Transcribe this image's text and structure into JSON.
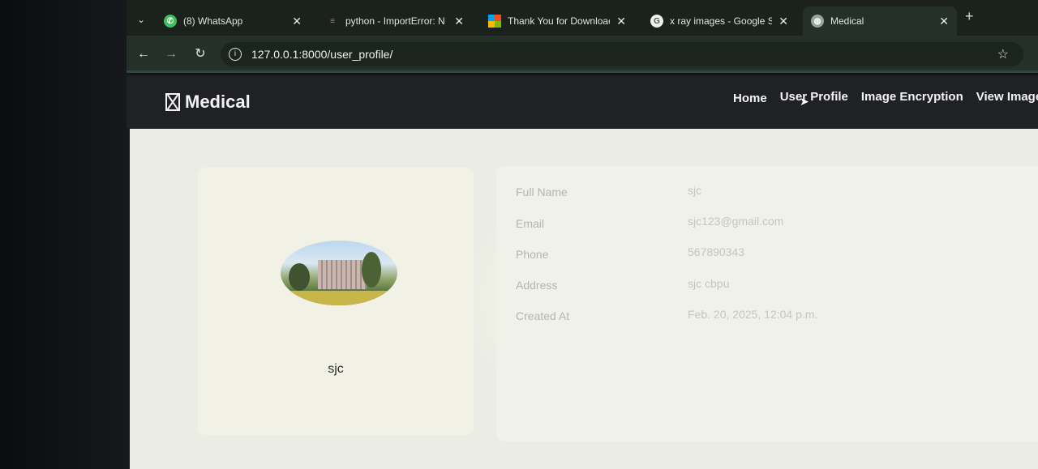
{
  "browser": {
    "tabs": [
      {
        "title": "(8) WhatsApp",
        "favicon": "whatsapp-icon",
        "active": false
      },
      {
        "title": "python - ImportError: N",
        "favicon": "stackoverflow-icon",
        "active": false
      },
      {
        "title": "Thank You for Downloac",
        "favicon": "microsoft-icon",
        "active": false
      },
      {
        "title": "x ray images - Google S",
        "favicon": "google-icon",
        "active": false
      },
      {
        "title": "Medical",
        "favicon": "globe-icon",
        "active": true
      }
    ],
    "url": "127.0.0.1:8000/user_profile/"
  },
  "site": {
    "brand": "Medical",
    "nav": {
      "home": "Home",
      "user_profile": "User Profile",
      "image_encryption": "Image Encryption",
      "view_images": "View Images"
    }
  },
  "profile": {
    "name": "sjc",
    "fields": [
      {
        "label": "Full Name",
        "value": "sjc"
      },
      {
        "label": "Email",
        "value": "sjc123@gmail.com"
      },
      {
        "label": "Phone",
        "value": "567890343"
      },
      {
        "label": "Address",
        "value": "sjc cbpu"
      },
      {
        "label": "Created At",
        "value": "Feb. 20, 2025, 12:04 p.m."
      }
    ]
  },
  "colors": {
    "navbar_bg": "#1f2124",
    "page_bg": "#ebece4",
    "label_text": "#b3b6b0"
  }
}
